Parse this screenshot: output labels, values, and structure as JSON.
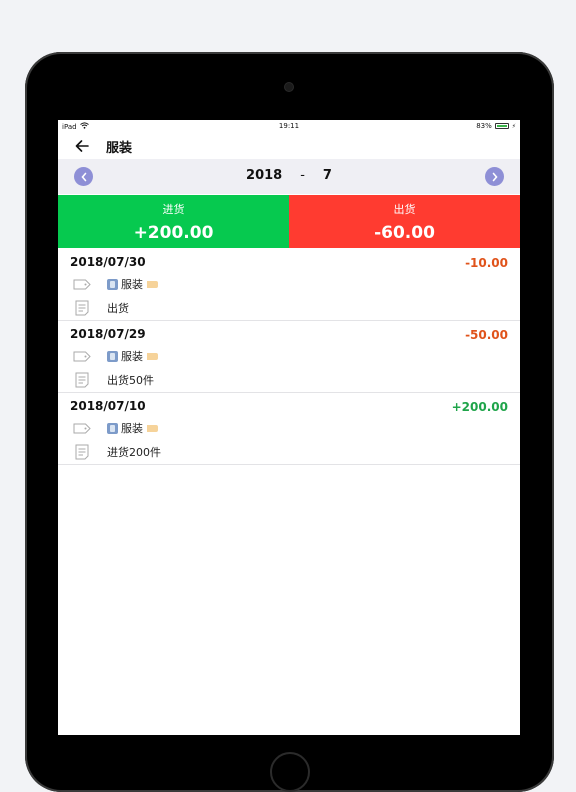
{
  "status_bar": {
    "device": "iPad",
    "time": "19:11",
    "battery": "83%"
  },
  "nav": {
    "title": "服装",
    "back_icon": "arrow-left-icon"
  },
  "month_selector": {
    "year": "2018",
    "separator": "-",
    "month": "7",
    "prev_icon": "chevron-left-icon",
    "next_icon": "chevron-right-icon"
  },
  "summary": {
    "in_label": "进货",
    "in_value": "+200.00",
    "out_label": "出货",
    "out_value": "-60.00",
    "in_color": "#06c94f",
    "out_color": "#ff3b30"
  },
  "records": [
    {
      "date": "2018/07/30",
      "amount": "-10.00",
      "category": "服装",
      "note": "出货"
    },
    {
      "date": "2018/07/29",
      "amount": "-50.00",
      "category": "服装",
      "note": "出货50件"
    },
    {
      "date": "2018/07/10",
      "amount": "+200.00",
      "category": "服装",
      "note": "进货200件"
    }
  ]
}
